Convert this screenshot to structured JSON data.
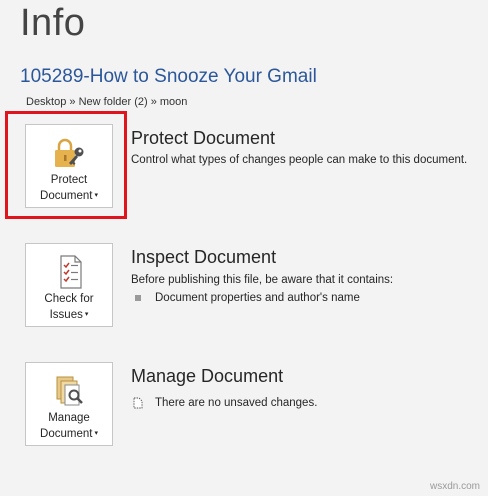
{
  "header": {
    "title": "Info",
    "document_name": "105289-How to Snooze Your Gmail",
    "path": "Desktop » New folder (2) » moon"
  },
  "sections": {
    "protect": {
      "button_line1": "Protect",
      "button_line2": "Document",
      "caret": "▾",
      "title": "Protect Document",
      "description": "Control what types of changes people can make to this document."
    },
    "inspect": {
      "button_line1": "Check for",
      "button_line2": "Issues",
      "caret": "▾",
      "title": "Inspect Document",
      "description": "Before publishing this file, be aware that it contains:",
      "items": [
        "Document properties and author's name"
      ]
    },
    "manage": {
      "button_line1": "Manage",
      "button_line2": "Document",
      "caret": "▾",
      "title": "Manage Document",
      "status": "There are no unsaved changes."
    }
  },
  "watermark": "wsxdn.com",
  "colors": {
    "accent": "#2b579a",
    "highlight": "#e0141c",
    "background": "#f3f3f3"
  }
}
